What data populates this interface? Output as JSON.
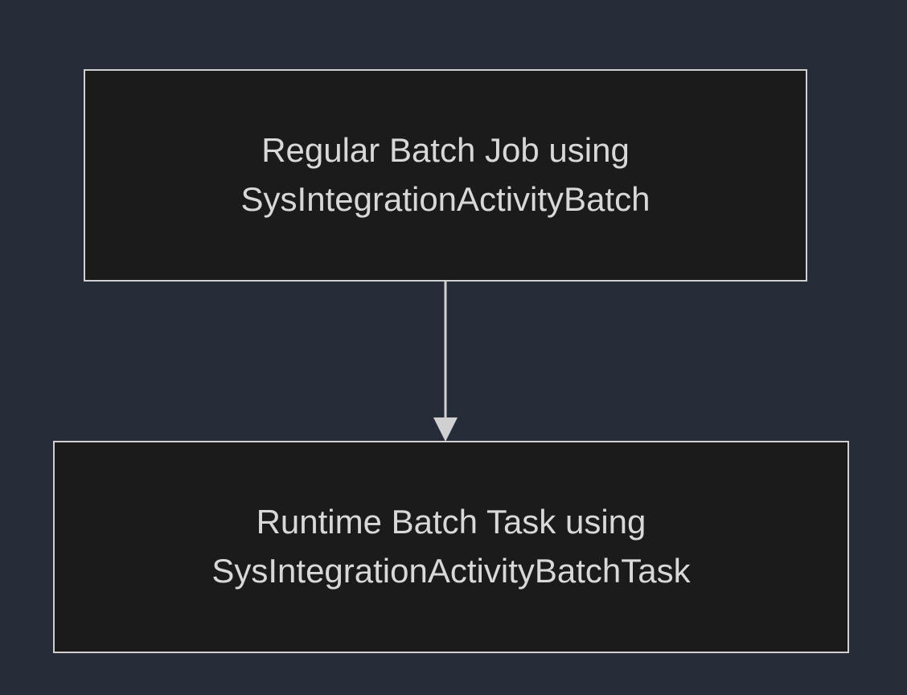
{
  "diagram": {
    "nodes": {
      "top": {
        "line1": "Regular Batch Job using",
        "line2": "SysIntegrationActivityBatch"
      },
      "bottom": {
        "line1": "Runtime Batch Task using",
        "line2": "SysIntegrationActivityBatchTask"
      }
    },
    "colors": {
      "background": "#262c38",
      "node_fill": "#1b1b1b",
      "node_border": "#d0d0d0",
      "text": "#d8d8d8",
      "arrow": "#d0d0d0"
    }
  }
}
